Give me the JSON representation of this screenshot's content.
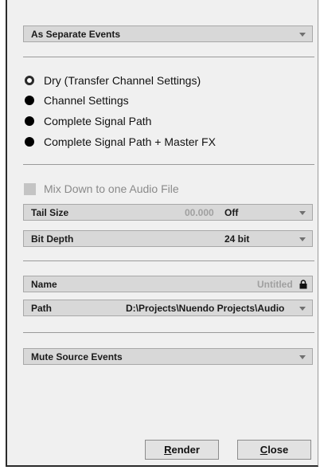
{
  "mode_dropdown": {
    "value": "As Separate Events"
  },
  "radio_options": [
    {
      "label": "Dry (Transfer Channel Settings)",
      "selected": true
    },
    {
      "label": "Channel Settings",
      "selected": false
    },
    {
      "label": "Complete Signal Path",
      "selected": false
    },
    {
      "label": "Complete Signal Path + Master FX",
      "selected": false
    }
  ],
  "mixdown_checkbox": {
    "label": "Mix Down to one Audio File",
    "checked": false,
    "enabled": false
  },
  "tail_size": {
    "label": "Tail Size",
    "number": "00.000",
    "value": "Off"
  },
  "bit_depth": {
    "label": "Bit Depth",
    "value": "24 bit"
  },
  "name_field": {
    "label": "Name",
    "value": "Untitled",
    "icon": "lock-icon"
  },
  "path_field": {
    "label": "Path",
    "value": "D:\\Projects\\Nuendo Projects\\Audio"
  },
  "source_events": {
    "value": "Mute Source Events"
  },
  "buttons": {
    "render": {
      "underline": "R",
      "rest": "ender"
    },
    "close": {
      "underline": "C",
      "rest": "lose"
    }
  }
}
